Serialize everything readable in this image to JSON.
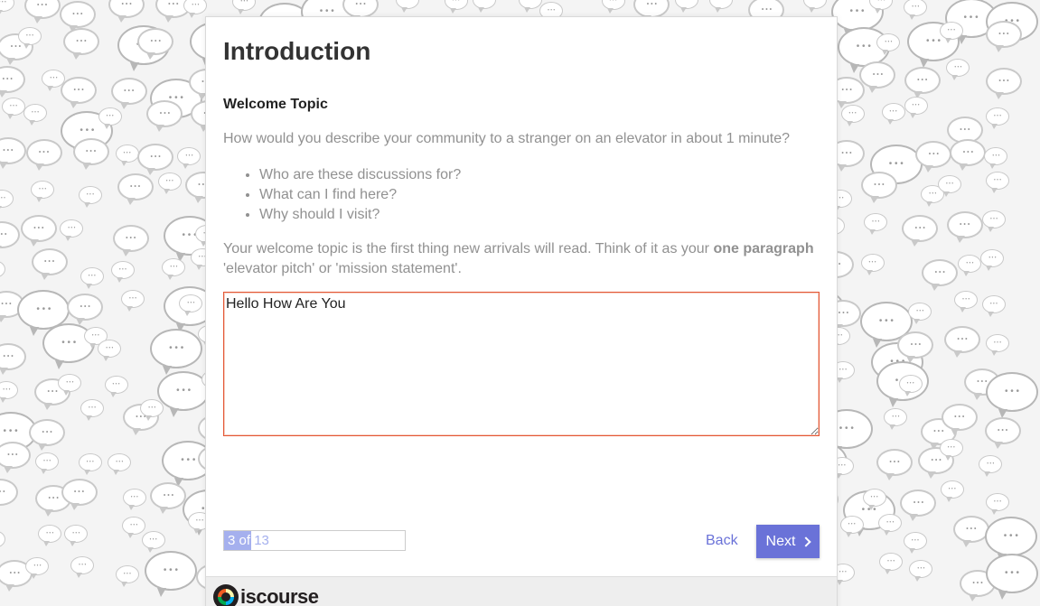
{
  "wizard": {
    "title": "Introduction",
    "field_label": "Welcome Topic",
    "question": "How would you describe your community to a stranger on an elevator in about 1 minute?",
    "bullets": [
      "Who are these discussions for?",
      "What can I find here?",
      "Why should I visit?"
    ],
    "explanation_before": "Your welcome topic is the first thing new arrivals will read. Think of it as your ",
    "explanation_bold": "one paragraph",
    "explanation_after": " 'elevator pitch' or 'mission statement'.",
    "textarea_value": "Hello How Are You",
    "progress": {
      "current": 3,
      "total": 13,
      "label_done": "3 of",
      "label_total": " 13"
    },
    "back_label": "Back",
    "next_label": "Next"
  },
  "footer": {
    "logo_text": "iscourse"
  },
  "icons": {
    "next": "chevron-right-icon",
    "logo": "discourse-logo-icon",
    "background": "speech-bubble-icon"
  },
  "colors": {
    "accent": "#6a72d8",
    "progress_fill": "#a5b0ee",
    "textarea_border": "#e45735",
    "muted_text": "#919191",
    "title_text": "#333333"
  }
}
